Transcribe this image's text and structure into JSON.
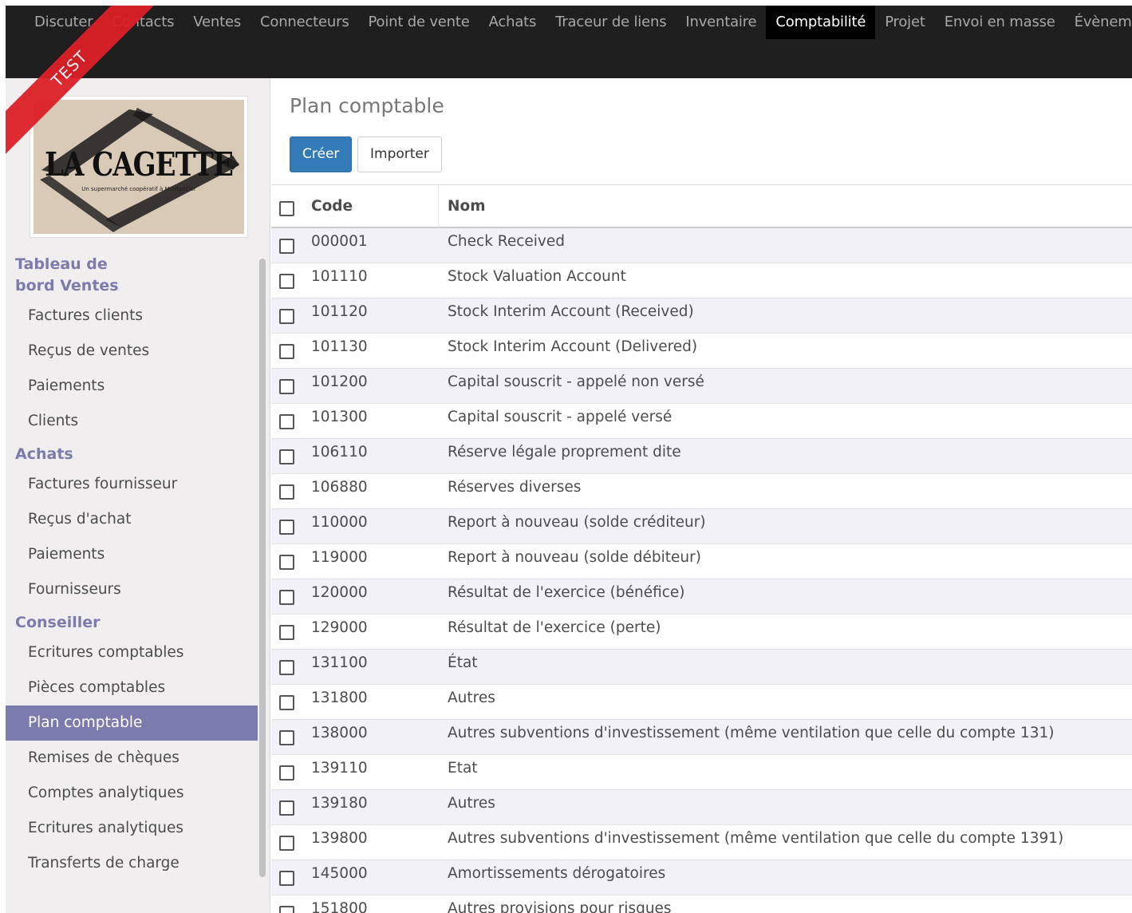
{
  "topnav": {
    "items": [
      "Discuter",
      "Contacts",
      "Ventes",
      "Connecteurs",
      "Point de vente",
      "Achats",
      "Traceur de liens",
      "Inventaire",
      "Comptabilité",
      "Projet",
      "Envoi en masse",
      "Évènem"
    ],
    "active_index": 8
  },
  "ribbon": {
    "label": "TEST",
    "color": "#dc1f26"
  },
  "logo": {
    "title": "LA CAGETTE",
    "subtitle": "Un supermarché coopératif à Montpellier"
  },
  "sidebar": {
    "sections": [
      {
        "label": "Tableau de bord Ventes",
        "entries": [
          "Factures clients",
          "Reçus de ventes",
          "Paiements",
          "Clients"
        ]
      },
      {
        "label": "Achats",
        "entries": [
          "Factures fournisseur",
          "Reçus d'achat",
          "Paiements",
          "Fournisseurs"
        ]
      },
      {
        "label": "Conseiller",
        "entries": [
          "Ecritures comptables",
          "Pièces comptables",
          "Plan comptable",
          "Remises de chèques",
          "Comptes analytiques",
          "Ecritures analytiques",
          "Transferts de charge"
        ]
      }
    ],
    "active_entry": "Plan comptable",
    "accent_color": "#7c7bad"
  },
  "main": {
    "title": "Plan comptable",
    "create_label": "Créer",
    "import_label": "Importer"
  },
  "table": {
    "columns": [
      "Code",
      "Nom"
    ],
    "rows": [
      {
        "code": "000001",
        "name": "Check Received"
      },
      {
        "code": "101110",
        "name": "Stock Valuation Account"
      },
      {
        "code": "101120",
        "name": "Stock Interim Account (Received)"
      },
      {
        "code": "101130",
        "name": "Stock Interim Account (Delivered)"
      },
      {
        "code": "101200",
        "name": "Capital souscrit - appelé non versé"
      },
      {
        "code": "101300",
        "name": "Capital souscrit - appelé versé"
      },
      {
        "code": "106110",
        "name": "Réserve légale proprement dite"
      },
      {
        "code": "106880",
        "name": "Réserves diverses"
      },
      {
        "code": "110000",
        "name": "Report à nouveau (solde créditeur)"
      },
      {
        "code": "119000",
        "name": "Report à nouveau (solde débiteur)"
      },
      {
        "code": "120000",
        "name": "Résultat de l'exercice (bénéfice)"
      },
      {
        "code": "129000",
        "name": "Résultat de l'exercice (perte)"
      },
      {
        "code": "131100",
        "name": "État"
      },
      {
        "code": "131800",
        "name": "Autres"
      },
      {
        "code": "138000",
        "name": "Autres subventions d'investissement (même ventilation que celle du compte 131)"
      },
      {
        "code": "139110",
        "name": "Etat"
      },
      {
        "code": "139180",
        "name": "Autres"
      },
      {
        "code": "139800",
        "name": "Autres subventions d'investissement (même ventilation que celle du compte 1391)"
      },
      {
        "code": "145000",
        "name": "Amortissements dérogatoires"
      },
      {
        "code": "151800",
        "name": "Autres provisions pour risques"
      }
    ]
  }
}
